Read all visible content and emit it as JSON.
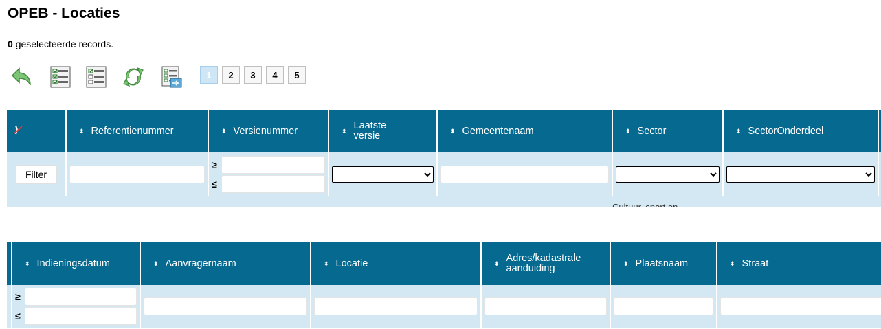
{
  "page": {
    "title": "OPEB - Locaties"
  },
  "records": {
    "count": "0",
    "label": "geselecteerde records."
  },
  "toolbar": {
    "icons": [
      "undo-arrow-icon",
      "checklist-icon",
      "checklist-icon",
      "refresh-icon",
      "export-list-icon"
    ]
  },
  "pager": {
    "pages": [
      "1",
      "2",
      "3",
      "4",
      "5"
    ],
    "active": "1"
  },
  "table_top": {
    "corner_icon": "column-toggle-icon",
    "columns": [
      "Referentienummer",
      "Versienummer",
      "Laatste versie",
      "Gemeentenaam",
      "Sector",
      "SectorOnderdeel"
    ],
    "filter_button": "Filter",
    "range_ge": "≥",
    "range_le": "≤",
    "first_row_peek": "Cultuur, sport en"
  },
  "table_bottom": {
    "columns": [
      "Indieningsdatum",
      "Aanvragernaam",
      "Locatie",
      "Adres/kadastrale aanduiding",
      "Plaatsnaam",
      "Straat"
    ],
    "range_ge": "≥",
    "range_le": "≤"
  },
  "sort_icon": "⬍",
  "colors": {
    "header_bg": "#06698f",
    "filter_bg": "#d3e8f2",
    "active_page": "#cfe6f7"
  }
}
